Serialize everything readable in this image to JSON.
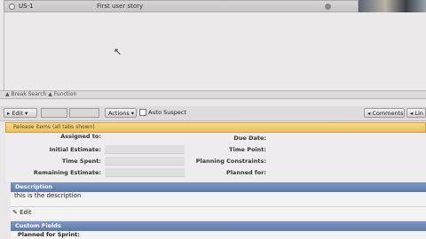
{
  "story_row": {
    "id": "US-1",
    "title": "First user story"
  },
  "splitter": {
    "label": "▲ Break Search ▲ Function"
  },
  "toolbar": {
    "edit_label": "▸ Edit ▾",
    "actions_label": "Actions ▾",
    "auto_suspect_label": "Auto Suspect",
    "comments_label": "◂ Comments",
    "links_label": "◂ Lin"
  },
  "banner": {
    "text": "Release items (all tabs shown)"
  },
  "fields": {
    "assigned_to": "Assigned to:",
    "initial_estimate": "Initial Estimate:",
    "time_spent": "Time Spent:",
    "remaining_estimate": "Remaining Estimate:",
    "due_date": "Due Date:",
    "time_point": "Time Point:",
    "planning_constraints": "Planning Constraints:",
    "planned_for": "Planned for:"
  },
  "description": {
    "header": "Description",
    "text": "this is the description",
    "edit_label": "✎ Edit"
  },
  "custom_fields": {
    "header": "Custom Fields",
    "planned_for_sprint": "Planned for Sprint:"
  }
}
